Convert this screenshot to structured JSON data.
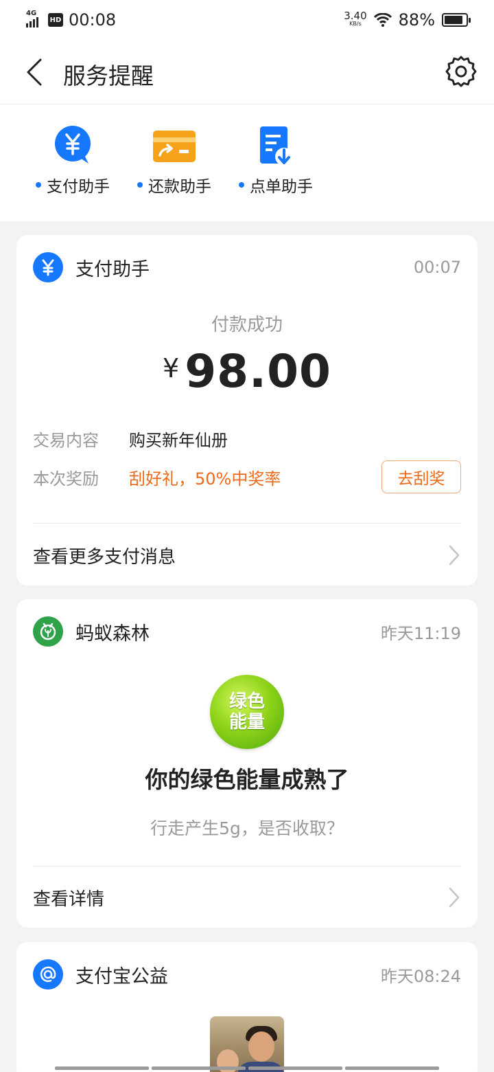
{
  "status_bar": {
    "network": "4G",
    "hd": "HD",
    "time": "00:08",
    "speed_value": "3.40",
    "speed_unit": "KB/s",
    "battery_percent": "88%",
    "battery_level": 0.88
  },
  "nav": {
    "title": "服务提醒",
    "back_icon": "chevron-left-icon",
    "settings_icon": "gear-icon"
  },
  "shortcuts": [
    {
      "label": "支付助手",
      "icon": "yuan-bubble-icon",
      "color": "#1677ff"
    },
    {
      "label": "还款助手",
      "icon": "card-repay-icon",
      "color": "#f7a21b"
    },
    {
      "label": "点单助手",
      "icon": "order-download-icon",
      "color": "#1677ff"
    }
  ],
  "payment_card": {
    "sender": "支付助手",
    "time": "00:07",
    "status": "付款成功",
    "currency": "¥",
    "amount": "98.00",
    "rows": [
      {
        "key": "交易内容",
        "value": "购买新年仙册"
      },
      {
        "key": "本次奖励",
        "value": "刮好礼，50%中奖率"
      }
    ],
    "action_button": "去刮奖",
    "more_link": "查看更多支付消息"
  },
  "forest_card": {
    "sender": "蚂蚁森林",
    "time": "昨天11:19",
    "ball_line1": "绿色",
    "ball_line2": "能量",
    "title": "你的绿色能量成熟了",
    "subtitle": "行走产生5g，是否收取？",
    "more_link": "查看详情"
  },
  "charity_card": {
    "sender": "支付宝公益",
    "time": "昨天08:24"
  },
  "colors": {
    "accent_blue": "#1677ff",
    "accent_orange": "#ef6a18",
    "forest_green": "#2fa24a"
  }
}
